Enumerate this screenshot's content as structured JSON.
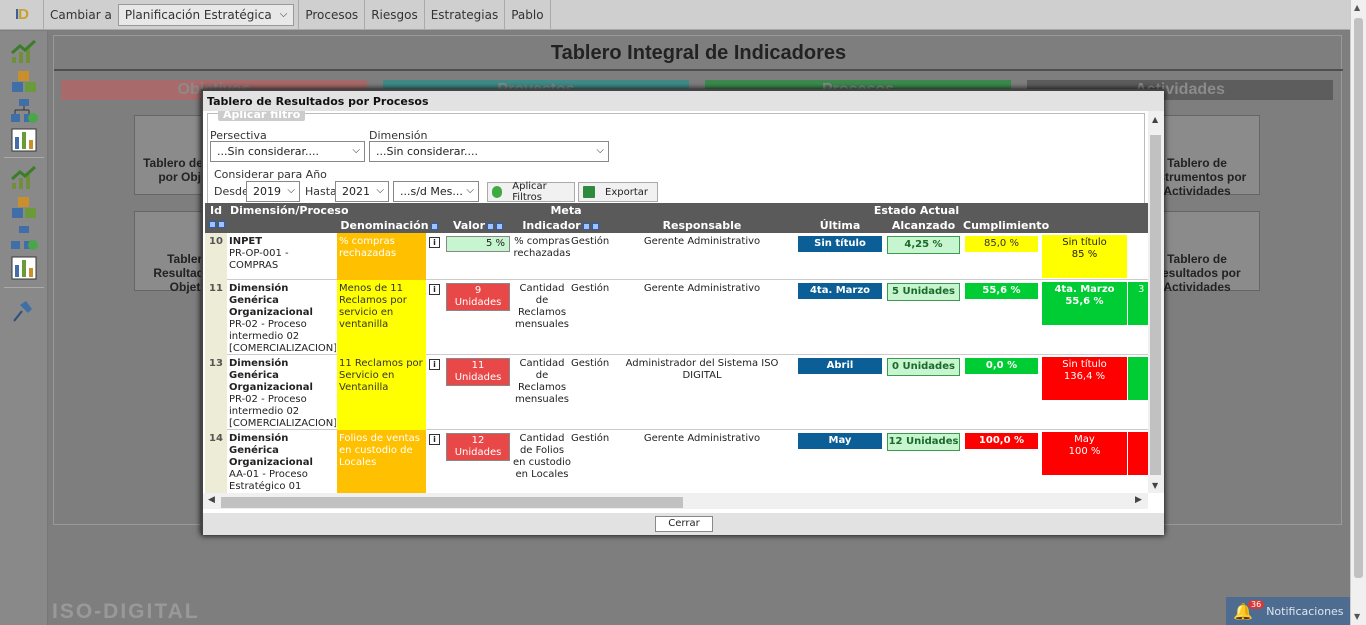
{
  "topbar": {
    "cambiar": "Cambiar a",
    "plan": "Planificación Estratégica",
    "nav": [
      "Procesos",
      "Riesgos",
      "Estrategias",
      "Pablo"
    ]
  },
  "dashboard": {
    "title": "Tablero Integral de Indicadores",
    "tabs": [
      "Objetivos",
      "Proyectos",
      "Procesos",
      "Actividades"
    ],
    "cards": [
      "Tablero de Gestión por Objetivos",
      "Tablero de Instrumentos por Actividades",
      "Tablero de Resultados por Objetivos",
      "Tablero de Resultados por Actividades"
    ]
  },
  "footer": {
    "brand": "ISO-DIGITAL",
    "notif_label": "Notificaciones",
    "notif_count": "36"
  },
  "modal": {
    "title": "Tablero de Resultados por Procesos",
    "filter_legend": "Aplicar filtro",
    "persp_label": "Persectiva",
    "persp_value": "...Sin considerar....",
    "dim_label": "Dimensión",
    "dim_value": "...Sin considerar....",
    "year_label": "Considerar para Año",
    "desde_label": "Desde",
    "desde_value": "2019",
    "hasta_label": "Hasta",
    "hasta_value": "2021",
    "mes_value": "...s/d Mes...",
    "apply_label": "Aplicar Filtros",
    "export_label": "Exportar",
    "close_label": "Cerrar"
  },
  "table": {
    "h_meta": "Meta",
    "h_estado": "Estado Actual",
    "h_id": "Id",
    "h_dim": "Dimensión/Proceso",
    "h_denom": "Denominación",
    "h_valor": "Valor",
    "h_indicador": "Indicador",
    "h_responsable": "Responsable",
    "h_ultima": "Última Medición",
    "h_alcanzado": "Alcanzado",
    "h_cumplimiento": "Cumplimiento",
    "rows": [
      {
        "id": "10",
        "dim_title": "INPET",
        "dim_sub": "PR-OP-001 - COMPRAS",
        "denom": "% compras rechazadas",
        "valor": "5 %",
        "indicador": "% compras rechazadas",
        "tipo": "Gestión",
        "responsable": "Gerente Administrativo",
        "ultima": "Sin título",
        "alcanzado": "4,25 %",
        "cumplimiento": "85,0 %",
        "extra1": "Sin título\n85 %",
        "extra2": ""
      },
      {
        "id": "11",
        "dim_title": "Dimensión Genérica Organizacional",
        "dim_sub": "PR-02 - Proceso intermedio 02 [COMERCIALIZACION]",
        "denom": "Menos de 11 Reclamos por servicio en ventanilla",
        "valor": "9 Unidades",
        "indicador": "Cantidad de Reclamos mensuales",
        "tipo": "Gestión",
        "responsable": "Gerente Administrativo",
        "ultima": "4ta. Marzo",
        "alcanzado": "5 Unidades",
        "cumplimiento": "55,6 %",
        "extra1": "4ta. Marzo\n55,6 %",
        "extra2": "3"
      },
      {
        "id": "13",
        "dim_title": "Dimensión Genérica Organizacional",
        "dim_sub": "PR-02 - Proceso intermedio 02 [COMERCIALIZACION]",
        "denom": "11 Reclamos por Servicio en Ventanilla",
        "valor": "11 Unidades",
        "indicador": "Cantidad de Reclamos mensuales",
        "tipo": "Gestión",
        "responsable": "Administrador del Sistema ISO DIGITAL",
        "ultima": "Abril",
        "alcanzado": "0 Unidades",
        "cumplimiento": "0,0 %",
        "extra1": "Sin título\n136,4 %",
        "extra2": ""
      },
      {
        "id": "14",
        "dim_title": "Dimensión Genérica Organizacional",
        "dim_sub": "AA-01 - Proceso Estratégico 01",
        "denom": "Folios de ventas en custodio de Locales",
        "valor": "12 Unidades",
        "indicador": "Cantidad de Folios en custodio en Locales",
        "tipo": "Gestión",
        "responsable": "Gerente Administrativo",
        "ultima": "May",
        "alcanzado": "12 Unidades",
        "cumplimiento": "100,0 %",
        "extra1": "May\n100 %",
        "extra2": ""
      }
    ]
  },
  "colors": {
    "yellow": "#ffff00",
    "orange": "#ffc000",
    "red": "#ff0000",
    "green": "#00cc33",
    "blue": "#0b5f96",
    "red_badge": "#e84848",
    "green_badge": "#c6f5cf"
  },
  "icons": [
    "chart-up-icon",
    "cubes-icon",
    "hierarchy-icon",
    "bars-icon",
    "pin-icon",
    "bell-icon",
    "info-icon",
    "check-icon",
    "excel-icon"
  ]
}
